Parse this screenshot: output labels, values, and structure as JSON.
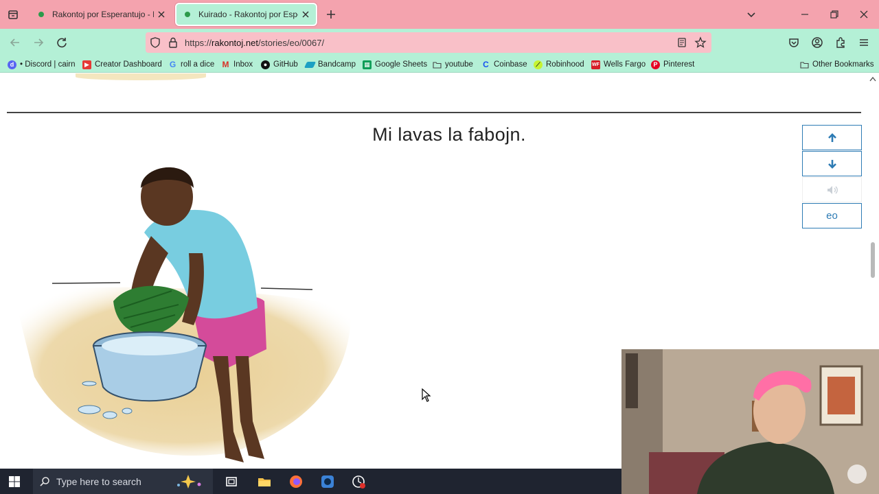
{
  "browser": {
    "tabs": [
      {
        "title": "Rakontoj por Esperantujo - Esp",
        "active": false
      },
      {
        "title": "Kuirado - Rakontoj por Esperan",
        "active": true
      }
    ],
    "url_prefix": "https://",
    "url_host": "rakontoj.net",
    "url_path": "/stories/eo/0067/",
    "bookmarks": [
      {
        "label": "• Discord | cairn",
        "icon": "discord-icon",
        "color": "#5865f2"
      },
      {
        "label": "Creator Dashboard",
        "icon": "youtube-studio-icon",
        "color": "#e53935"
      },
      {
        "label": "roll a dice",
        "icon": "google-icon",
        "color": "#4285f4"
      },
      {
        "label": "Inbox",
        "icon": "gmail-icon",
        "color": "#d93025"
      },
      {
        "label": "GitHub",
        "icon": "github-icon",
        "color": "#111111"
      },
      {
        "label": "Bandcamp",
        "icon": "bandcamp-icon",
        "color": "#1da0c3"
      },
      {
        "label": "Google Sheets",
        "icon": "sheets-icon",
        "color": "#0f9d58"
      },
      {
        "label": "youtube",
        "icon": "folder-icon",
        "color": "#444444"
      },
      {
        "label": "Coinbase",
        "icon": "coinbase-icon",
        "color": "#1652f0"
      },
      {
        "label": "Robinhood",
        "icon": "robinhood-icon",
        "color": "#3a7d12"
      },
      {
        "label": "Wells Fargo",
        "icon": "wells-fargo-icon",
        "color": "#d71e28"
      },
      {
        "label": "Pinterest",
        "icon": "pinterest-icon",
        "color": "#e60023"
      }
    ],
    "other_bookmarks": "Other Bookmarks"
  },
  "story": {
    "sentence": "Mi lavas la fabojn.",
    "controls": {
      "up": "up-arrow-icon",
      "down": "down-arrow-icon",
      "audio": "speaker-icon",
      "language": "eo"
    }
  },
  "taskbar": {
    "search_placeholder": "Type here to search"
  },
  "colors": {
    "titlebar": "#f4a3ae",
    "navbar": "#b4f0d6",
    "urlbar": "#f9c0c8",
    "accent_blue": "#2d7bb4"
  }
}
